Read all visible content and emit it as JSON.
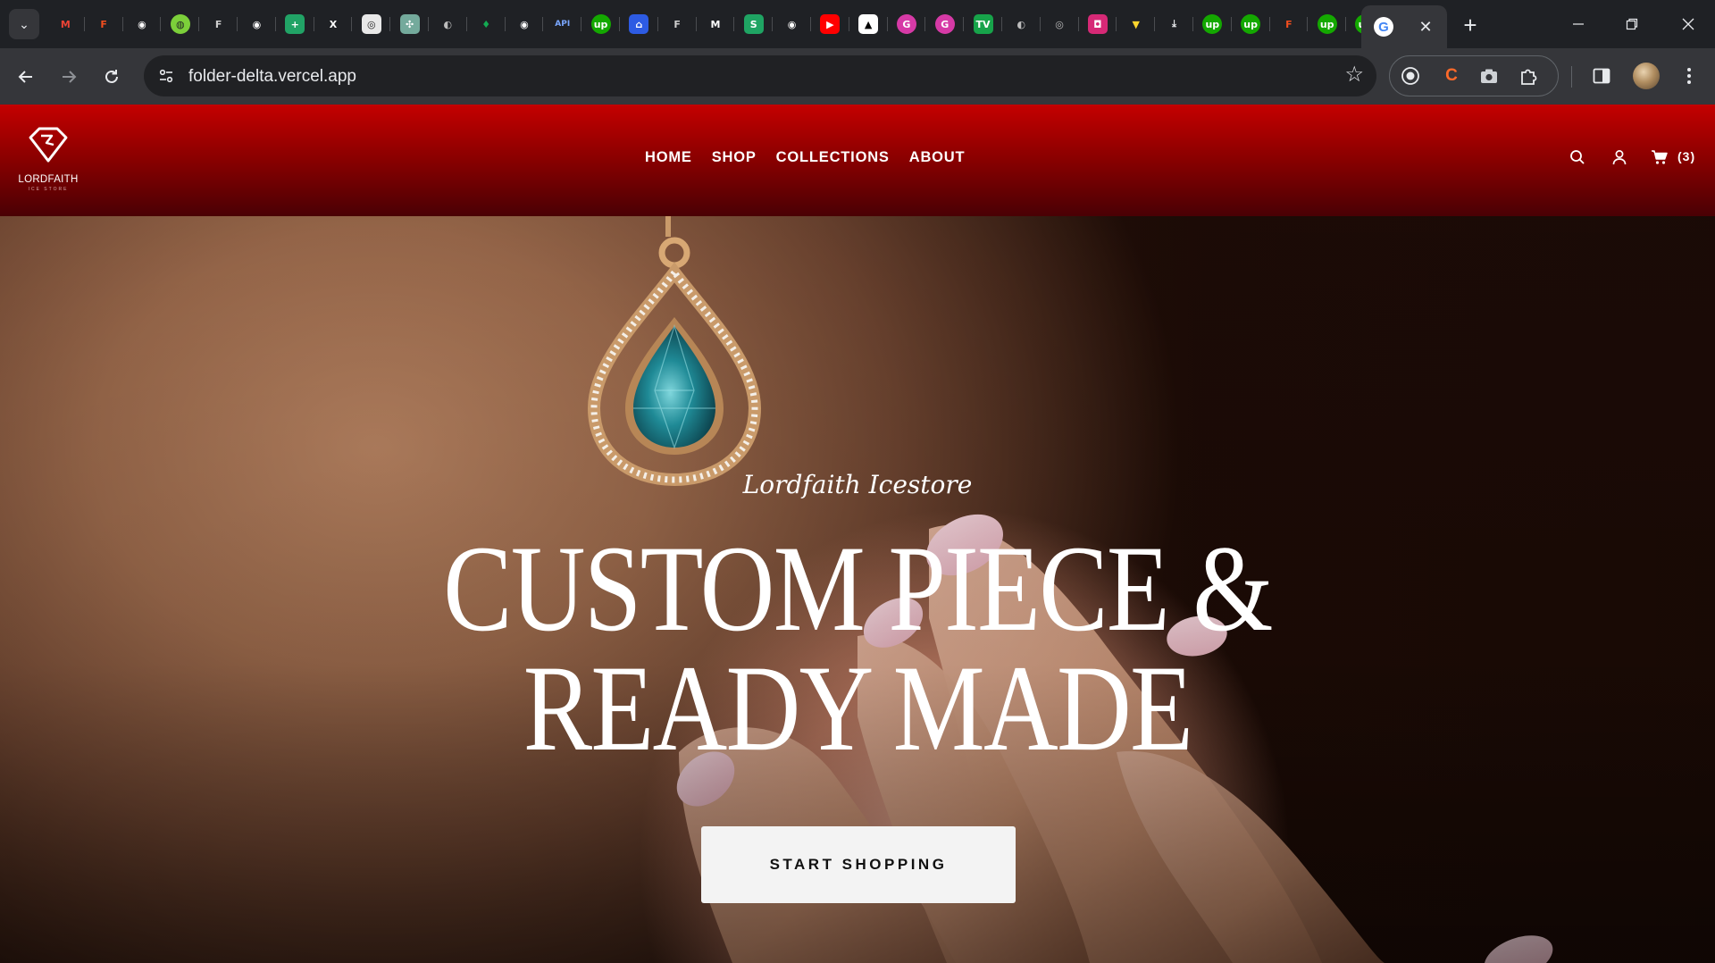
{
  "browser": {
    "tabs": [
      {
        "icon": "gmail-icon",
        "glyph": "M",
        "color": "#ea4335",
        "bg": "transparent"
      },
      {
        "icon": "figma-icon",
        "glyph": "F",
        "color": "#f24e1e",
        "bg": "transparent"
      },
      {
        "icon": "github-icon",
        "glyph": "◉",
        "color": "#ffffff",
        "bg": "transparent"
      },
      {
        "icon": "globe-green-icon",
        "glyph": "◍",
        "color": "#1f2125",
        "bg": "#7ccf3a"
      },
      {
        "icon": "figma-gray-icon",
        "glyph": "F",
        "color": "#cfcfcf",
        "bg": "transparent"
      },
      {
        "icon": "github-icon",
        "glyph": "◉",
        "color": "#ffffff",
        "bg": "transparent"
      },
      {
        "icon": "sheets-icon",
        "glyph": "+",
        "color": "#ffffff",
        "bg": "#21a366"
      },
      {
        "icon": "x-icon",
        "glyph": "X",
        "color": "#ffffff",
        "bg": "transparent"
      },
      {
        "icon": "app-icon",
        "glyph": "◎",
        "color": "#222222",
        "bg": "#e8e8e8"
      },
      {
        "icon": "chatgpt-icon",
        "glyph": "✣",
        "color": "#ffffff",
        "bg": "#74aa9c"
      },
      {
        "icon": "globe-icon",
        "glyph": "◐",
        "color": "#bdbdbd",
        "bg": "transparent"
      },
      {
        "icon": "mongodb-icon",
        "glyph": "♦",
        "color": "#13aa52",
        "bg": "transparent"
      },
      {
        "icon": "github-icon",
        "glyph": "◉",
        "color": "#ffffff",
        "bg": "transparent"
      },
      {
        "icon": "api-icon",
        "glyph": "API",
        "color": "#7aa7ff",
        "bg": "transparent"
      },
      {
        "icon": "upwork-icon",
        "glyph": "up",
        "color": "#ffffff",
        "bg": "#14a800"
      },
      {
        "icon": "bank-icon",
        "glyph": "⌂",
        "color": "#ffffff",
        "bg": "#2d5be3"
      },
      {
        "icon": "figma-gray-icon",
        "glyph": "F",
        "color": "#cfcfcf",
        "bg": "transparent"
      },
      {
        "icon": "medium-icon",
        "glyph": "M",
        "color": "#ffffff",
        "bg": "transparent"
      },
      {
        "icon": "sheets-s-icon",
        "glyph": "S",
        "color": "#ffffff",
        "bg": "#1fa463"
      },
      {
        "icon": "github-icon",
        "glyph": "◉",
        "color": "#ffffff",
        "bg": "transparent"
      },
      {
        "icon": "youtube-icon",
        "glyph": "▶",
        "color": "#ffffff",
        "bg": "#ff0000"
      },
      {
        "icon": "triangle-icon",
        "glyph": "▲",
        "color": "#000000",
        "bg": "#ffffff"
      },
      {
        "icon": "g-pink-icon",
        "glyph": "G",
        "color": "#ffffff",
        "bg": "#d63aa6"
      },
      {
        "icon": "g-pink-icon",
        "glyph": "G",
        "color": "#ffffff",
        "bg": "#d63aa6"
      },
      {
        "icon": "tv-icon",
        "glyph": "TV",
        "color": "#ffffff",
        "bg": "#17a34a"
      },
      {
        "icon": "globe-icon",
        "glyph": "◐",
        "color": "#bdbdbd",
        "bg": "transparent"
      },
      {
        "icon": "chrome-icon",
        "glyph": "◎",
        "color": "#bdbdbd",
        "bg": "transparent"
      },
      {
        "icon": "instagram-icon",
        "glyph": "◘",
        "color": "#ffffff",
        "bg": "#d62976"
      },
      {
        "icon": "vite-icon",
        "glyph": "▼",
        "color": "#ffd62e",
        "bg": "transparent"
      },
      {
        "icon": "download-icon",
        "glyph": "⤓",
        "color": "#e8eaed",
        "bg": "transparent"
      },
      {
        "icon": "upwork-icon",
        "glyph": "up",
        "color": "#ffffff",
        "bg": "#14a800"
      },
      {
        "icon": "upwork-icon",
        "glyph": "up",
        "color": "#ffffff",
        "bg": "#14a800"
      },
      {
        "icon": "figma-icon",
        "glyph": "F",
        "color": "#f24e1e",
        "bg": "transparent"
      },
      {
        "icon": "upwork-icon",
        "glyph": "up",
        "color": "#ffffff",
        "bg": "#14a800"
      },
      {
        "icon": "upwork-icon",
        "glyph": "up",
        "color": "#ffffff",
        "bg": "#14a800"
      }
    ],
    "active_tab": {
      "icon": "google-icon",
      "glyph": "G"
    },
    "url": "folder-delta.vercel.app"
  },
  "site": {
    "logo_text": "LORDFAITH",
    "logo_subtext": "ICE STORE",
    "nav": [
      "HOME",
      "SHOP",
      "COLLECTIONS",
      "ABOUT"
    ],
    "cart_count": "(3)"
  },
  "hero": {
    "tagline": "Lordfaith Icestore",
    "title_line1": "CUSTOM PIECE &",
    "title_line2": "READY MADE",
    "cta": "START SHOPPING"
  },
  "colors": {
    "header_red": "#c40000",
    "header_dark": "#4a0004",
    "gem_teal": "#1f8a96",
    "pendant_gold": "#c99a6a"
  }
}
